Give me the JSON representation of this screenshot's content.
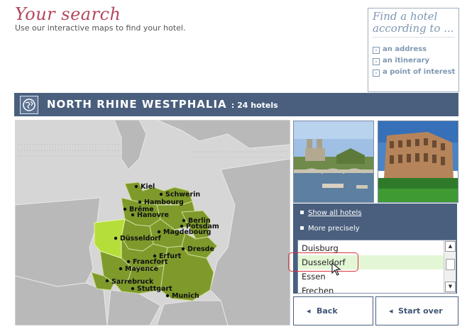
{
  "header": {
    "title": "Your search",
    "subtitle": "Use our interactive maps to find your hotel."
  },
  "find_box": {
    "title": "Find a hotel according to ...",
    "links": [
      "an address",
      "an itinerary",
      "a point of interest"
    ]
  },
  "region": {
    "name": "NORTH RHINE WESTPHALIA",
    "count": ": 24 hotels"
  },
  "map": {
    "cities": [
      "Kiel",
      "Schwerin",
      "Hambourg",
      "Brême",
      "Hanovre",
      "Berlin",
      "Potsdam",
      "Magdebourg",
      "Düsseldorf",
      "Dresde",
      "Erfurt",
      "Francfort",
      "Mayence",
      "Sarrebruck",
      "Stuttgart",
      "Munich"
    ]
  },
  "panel": {
    "show_all": "Show all hotels",
    "more_precisely": "More precisely",
    "list": [
      "Duisburg",
      "Dusseldorf",
      "Essen",
      "Frechen"
    ],
    "selected": "Dusseldorf"
  },
  "buttons": {
    "back": "Back",
    "start_over": "Start over"
  },
  "colors": {
    "title": "#b5475c",
    "bar": "#4a5f7e",
    "map_green": "#7e9a2b",
    "map_highlight": "#b6de3a",
    "selection": "#e3f7d6"
  },
  "icons": [
    "globe-icon",
    "arrow-right-icon",
    "arrow-left-icon",
    "scroll-up-icon",
    "scroll-down-icon",
    "cursor-icon"
  ]
}
